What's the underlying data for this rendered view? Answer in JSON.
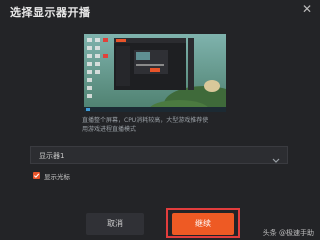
{
  "dialog": {
    "title": "选择显示器开播",
    "close_icon": "close-icon"
  },
  "preview": {
    "description_line1": "直播整个屏幕，CPU消耗较高，大型游戏推荐使",
    "description_line2": "用游戏进程直播模式"
  },
  "monitor_select": {
    "value": "显示器1",
    "icon": "chevron-down-icon"
  },
  "show_cursor": {
    "label": "显示光标",
    "checked": true
  },
  "buttons": {
    "cancel": "取消",
    "continue": "继续"
  },
  "watermark": "头条 @极速手助",
  "colors": {
    "accent": "#ee5a24",
    "highlight_border": "#e23d3d",
    "background": "#232427"
  }
}
